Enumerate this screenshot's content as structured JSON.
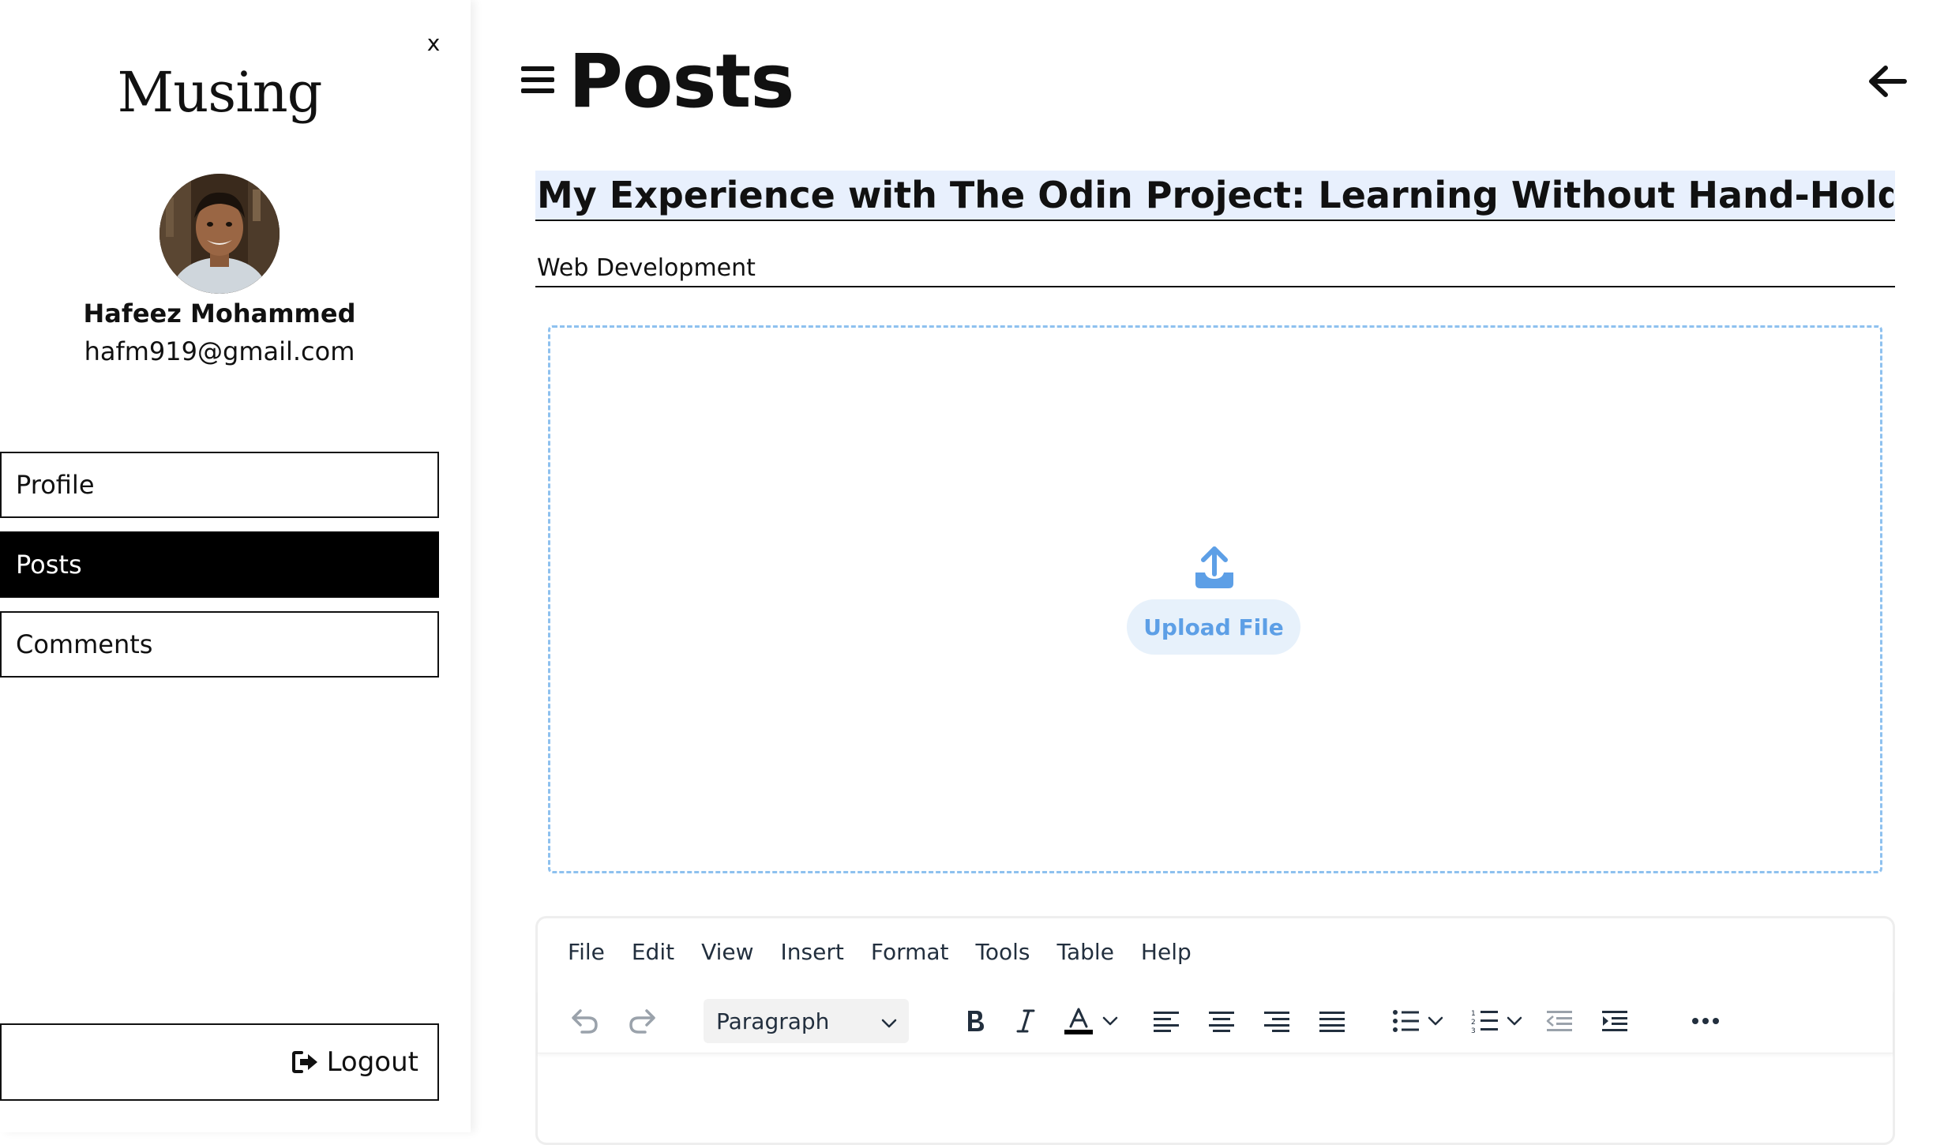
{
  "sidebar": {
    "close_label": "x",
    "brand": "Musing",
    "user": {
      "name": "Hafeez Mohammed",
      "email": "hafm919@gmail.com"
    },
    "nav": {
      "profile": "Profile",
      "posts": "Posts",
      "comments": "Comments"
    },
    "logout_label": "Logout",
    "active_nav": "posts"
  },
  "main": {
    "page_title": "Posts",
    "post_title": "My Experience with The Odin Project: Learning Without Hand-Holding",
    "category": "Web Development",
    "upload_label": "Upload File"
  },
  "editor": {
    "menus": {
      "file": "File",
      "edit": "Edit",
      "view": "View",
      "insert": "Insert",
      "format": "Format",
      "tools": "Tools",
      "table": "Table",
      "help": "Help"
    },
    "block_format": "Paragraph",
    "toolbar_icons": [
      "undo-icon",
      "redo-icon",
      "bold-icon",
      "italic-icon",
      "text-color-icon",
      "align-left-icon",
      "align-center-icon",
      "align-right-icon",
      "align-justify-icon",
      "bullet-list-icon",
      "numbered-list-icon",
      "outdent-icon",
      "indent-icon",
      "more-icon"
    ]
  },
  "colors": {
    "title_field_bg": "#e8f0fd",
    "upload_border": "#8ec1ef",
    "upload_accent": "#5d9fe6",
    "upload_button_bg": "#e7f1fb",
    "active_nav_bg": "#000000",
    "text_color_underline": "#000000"
  }
}
